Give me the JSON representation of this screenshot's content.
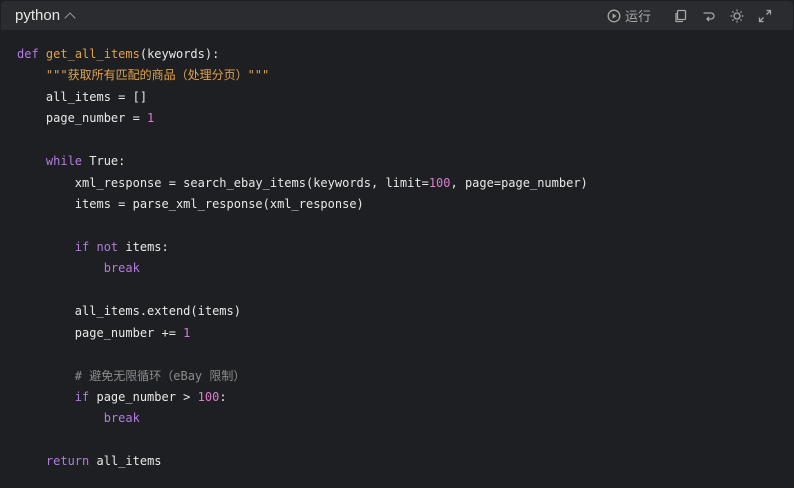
{
  "header": {
    "language": "python",
    "run_label": "运行"
  },
  "icons": {
    "collapse": "chevron-up-icon",
    "run": "play-circle-icon",
    "copy": "copy-icon",
    "wrap": "wrap-arrow-icon",
    "theme": "sun-icon",
    "expand": "expand-icon"
  },
  "code": {
    "lines": [
      [
        [
          "kw",
          "def"
        ],
        [
          "id",
          " "
        ],
        [
          "fn",
          "get_all_items"
        ],
        [
          "id",
          "(keywords):"
        ]
      ],
      [
        [
          "id",
          "    "
        ],
        [
          "str",
          "\"\"\"获取所有匹配的商品（处理分页）\"\"\""
        ]
      ],
      [
        [
          "id",
          "    all_items = []"
        ]
      ],
      [
        [
          "id",
          "    page_number = "
        ],
        [
          "num",
          "1"
        ]
      ],
      [
        [
          "id",
          ""
        ]
      ],
      [
        [
          "id",
          "    "
        ],
        [
          "kw",
          "while"
        ],
        [
          "id",
          " True:"
        ]
      ],
      [
        [
          "id",
          "        xml_response = search_ebay_items(keywords, limit="
        ],
        [
          "num",
          "100"
        ],
        [
          "id",
          ", page=page_number)"
        ]
      ],
      [
        [
          "id",
          "        items = parse_xml_response(xml_response)"
        ]
      ],
      [
        [
          "id",
          ""
        ]
      ],
      [
        [
          "id",
          "        "
        ],
        [
          "kw",
          "if"
        ],
        [
          "id",
          " "
        ],
        [
          "kw",
          "not"
        ],
        [
          "id",
          " items:"
        ]
      ],
      [
        [
          "id",
          "            "
        ],
        [
          "kw",
          "break"
        ]
      ],
      [
        [
          "id",
          ""
        ]
      ],
      [
        [
          "id",
          "        all_items.extend(items)"
        ]
      ],
      [
        [
          "id",
          "        page_number += "
        ],
        [
          "num",
          "1"
        ]
      ],
      [
        [
          "id",
          ""
        ]
      ],
      [
        [
          "id",
          "        "
        ],
        [
          "com",
          "# 避免无限循环（eBay 限制）"
        ]
      ],
      [
        [
          "id",
          "        "
        ],
        [
          "kw",
          "if"
        ],
        [
          "id",
          " page_number > "
        ],
        [
          "num",
          "100"
        ],
        [
          "id",
          ":"
        ]
      ],
      [
        [
          "id",
          "            "
        ],
        [
          "kw",
          "break"
        ]
      ],
      [
        [
          "id",
          ""
        ]
      ],
      [
        [
          "id",
          "    "
        ],
        [
          "kw",
          "return"
        ],
        [
          "id",
          " all_items"
        ]
      ]
    ]
  },
  "colors": {
    "background": "#1e1f22",
    "header": "#2b2c30",
    "keyword": "#b27be0",
    "function": "#e0a24a",
    "number": "#e07bd0",
    "comment": "#8c8c8c"
  }
}
